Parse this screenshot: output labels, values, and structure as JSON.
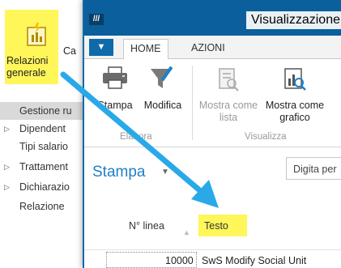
{
  "background_app": {
    "ribbon": {
      "relazioni_label": "Relazioni generale",
      "truncated_label": "Ca"
    },
    "nav": [
      {
        "label": "Gestione ru",
        "expander": false,
        "selected": true
      },
      {
        "label": "Dipendent",
        "expander": true,
        "selected": false
      },
      {
        "label": "Tipi salario",
        "expander": false,
        "selected": false
      },
      {
        "label": "Trattament",
        "expander": true,
        "selected": false
      },
      {
        "label": "Dichiarazio",
        "expander": true,
        "selected": false
      },
      {
        "label": "Relazione",
        "expander": false,
        "selected": false
      }
    ]
  },
  "window": {
    "title": "Visualizzazione",
    "logo": "///",
    "menu_icon": "chevron-down-icon",
    "tabs": [
      {
        "label": "HOME",
        "active": true
      },
      {
        "label": "AZIONI",
        "active": false
      }
    ],
    "ribbon": {
      "buttons": {
        "stampa": "Stampa",
        "modifica": "Modifica",
        "mostra_lista": "Mostra come lista",
        "mostra_grafico": "Mostra come grafico"
      },
      "groups": {
        "elabora": "Elabora",
        "visualizza": "Visualizza"
      }
    },
    "page_heading": "Stampa",
    "search_placeholder": "Digita per",
    "columns": {
      "line_no": "N° linea",
      "text": "Testo"
    },
    "rows": [
      {
        "line_no": "10000",
        "text": "SwS Modify Social Unit"
      }
    ]
  },
  "colors": {
    "accent_blue": "#0b5f9c",
    "highlight_yellow": "#fff65a",
    "arrow_blue": "#29a9e8"
  }
}
